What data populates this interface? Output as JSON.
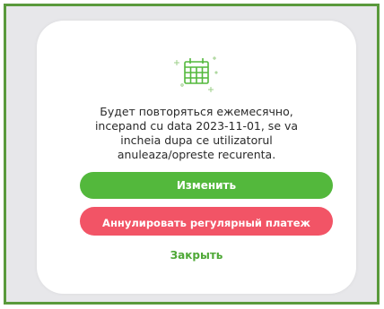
{
  "modal": {
    "icon": "calendar-icon",
    "message": "Будет повторяться ежемесячно,\nincepand cu data 2023-11-01, se va\nincheia dupa ce utilizatorul\nanuleaza/opreste recurenta.",
    "edit_button_label": "Изменить",
    "cancel_recurring_button_label": "Аннулировать регулярный платеж",
    "close_link_label": "Закрыть"
  },
  "colors": {
    "frame_border": "#5a9a3c",
    "background": "#e7e7ea",
    "primary_green": "#53b83c",
    "danger_red": "#f25466",
    "link_green": "#4ea836"
  }
}
